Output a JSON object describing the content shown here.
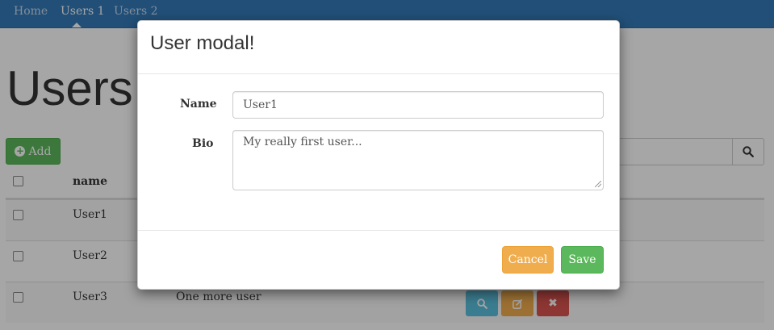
{
  "navbar": {
    "links": [
      {
        "label": "Home"
      },
      {
        "label": "Users 1"
      },
      {
        "label": "Users 2"
      }
    ]
  },
  "page": {
    "title": "Users",
    "add_label": "Add",
    "search": {
      "placeholder": ""
    }
  },
  "table": {
    "headers": {
      "name": "name"
    },
    "rows": [
      {
        "name": "User1",
        "bio": ""
      },
      {
        "name": "User2",
        "bio": ""
      },
      {
        "name": "User3",
        "bio": "One more user"
      }
    ]
  },
  "modal": {
    "title": "User modal!",
    "name_label": "Name",
    "name_value": "User1",
    "bio_label": "Bio",
    "bio_value": "My really first user...",
    "cancel_label": "Cancel",
    "save_label": "Save"
  },
  "colors": {
    "navbar": "#337ab7",
    "success": "#5cb85c",
    "warning": "#f0ad4e",
    "info": "#5bc0de",
    "danger": "#d9534f"
  },
  "icons": [
    "plus-circle-icon",
    "search-icon",
    "pencil-square-icon",
    "close-icon"
  ]
}
